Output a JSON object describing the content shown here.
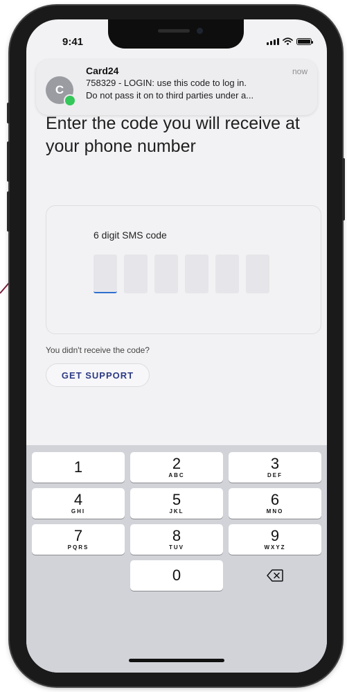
{
  "status_bar": {
    "time": "9:41"
  },
  "notification": {
    "app": "Card24",
    "time": "now",
    "avatar_letter": "C",
    "line1": "758329 - LOGIN: use this code to log in.",
    "line2": "Do not pass it on to third parties under a..."
  },
  "page": {
    "heading": "Enter the code you will receive at your phone number",
    "code_label": "6 digit SMS code",
    "code_digits": [
      "",
      "",
      "",
      "",
      "",
      ""
    ],
    "no_code_text": "You didn't receive the code?",
    "support_label": "GET SUPPORT"
  },
  "keypad": {
    "keys": [
      {
        "num": "1",
        "letters": ""
      },
      {
        "num": "2",
        "letters": "ABC"
      },
      {
        "num": "3",
        "letters": "DEF"
      },
      {
        "num": "4",
        "letters": "GHI"
      },
      {
        "num": "5",
        "letters": "JKL"
      },
      {
        "num": "6",
        "letters": "MNO"
      },
      {
        "num": "7",
        "letters": "PQRS"
      },
      {
        "num": "8",
        "letters": "TUV"
      },
      {
        "num": "9",
        "letters": "WXYZ"
      },
      {
        "num": "0",
        "letters": ""
      }
    ],
    "delete_icon": "backspace-icon"
  },
  "colors": {
    "accent_blue": "#2f6fcf",
    "support_text": "#2d3a84",
    "pointer_line": "#7a1f3a"
  }
}
